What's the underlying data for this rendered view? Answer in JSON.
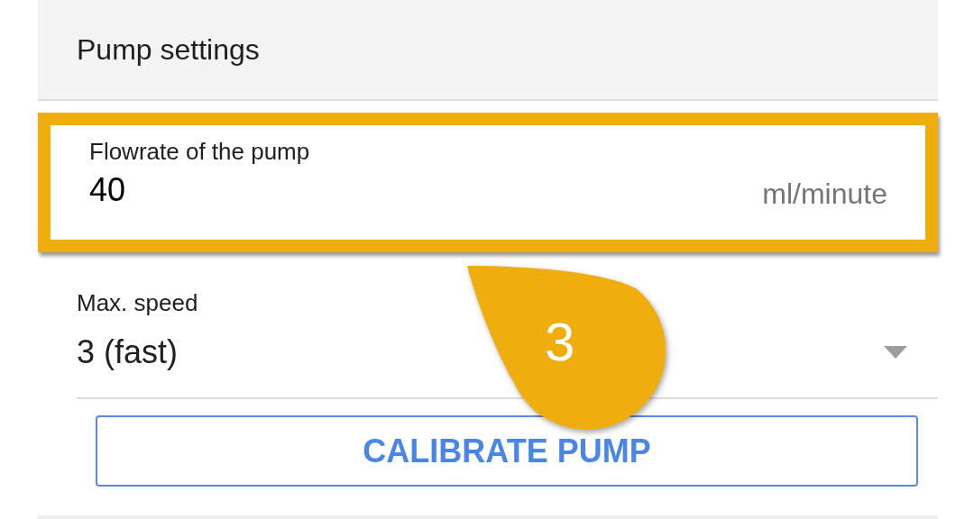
{
  "header": {
    "title": "Pump settings"
  },
  "flowrate": {
    "label": "Flowrate of the pump",
    "value": "40",
    "unit": "ml/minute",
    "highlighted": true
  },
  "max_speed": {
    "label": "Max. speed",
    "value": "3 (fast)"
  },
  "button": "CALIBRATE PUMP",
  "callout": {
    "number": "3"
  }
}
